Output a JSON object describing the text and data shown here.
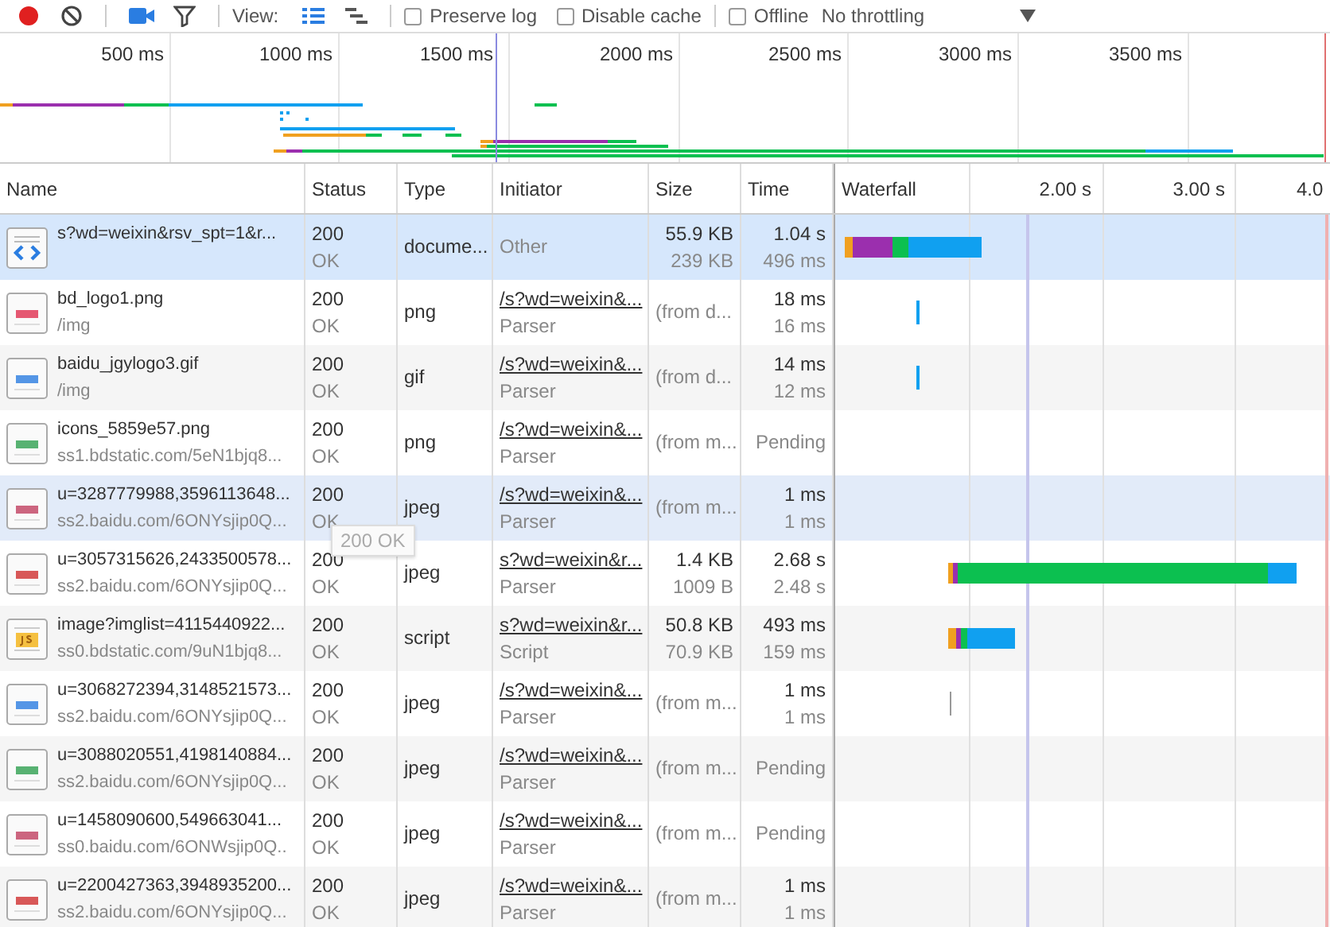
{
  "toolbar": {
    "recording": true,
    "view_label": "View:",
    "view_modes": [
      {
        "kind": "list",
        "selected": true
      },
      {
        "kind": "waterfall",
        "selected": false
      }
    ],
    "options": [
      {
        "label": "Preserve log",
        "checked": false
      },
      {
        "label": "Disable cache",
        "checked": false
      }
    ],
    "offline": {
      "label": "Offline",
      "checked": false
    },
    "throttling": "No throttling"
  },
  "overview": {
    "ticks": [
      "500 ms",
      "1000 ms",
      "1500 ms",
      "2000 ms",
      "2500 ms",
      "3000 ms",
      "3500 ms"
    ]
  },
  "table": {
    "columns": [
      "Name",
      "Status",
      "Type",
      "Initiator",
      "Size",
      "Time",
      "Waterfall"
    ],
    "waterfall_ticks": [
      "2.00 s",
      "3.00 s",
      "4.0"
    ],
    "rows": [
      {
        "kind": "document",
        "name": "s?wd=weixin&rsv_spt=1&r...",
        "status": "200",
        "status_text": "OK",
        "type": "docume...",
        "initiator_cause": "Other",
        "size": "55.9 KB",
        "resource_size": "239 KB",
        "time": "1.04 s",
        "latency": "496 ms",
        "selected": true,
        "hovered": false
      },
      {
        "kind": "image",
        "name": "bd_logo1.png",
        "path": "/img",
        "status": "200",
        "status_text": "OK",
        "type": "png",
        "initiator_link": "/s?wd=weixin&...",
        "initiator_cause": "Parser",
        "size": "(from d...",
        "time": "18 ms",
        "latency": "16 ms",
        "selected": false,
        "hovered": false
      },
      {
        "kind": "image",
        "name": "baidu_jgylogo3.gif",
        "path": "/img",
        "status": "200",
        "status_text": "OK",
        "type": "gif",
        "initiator_link": "/s?wd=weixin&...",
        "initiator_cause": "Parser",
        "size": "(from d...",
        "time": "14 ms",
        "latency": "12 ms",
        "selected": false,
        "hovered": false
      },
      {
        "kind": "image",
        "name": "icons_5859e57.png",
        "path": "ss1.bdstatic.com/5eN1bjq8...",
        "status": "200",
        "status_text": "OK",
        "type": "png",
        "initiator_link": "/s?wd=weixin&...",
        "initiator_cause": "Parser",
        "size": "(from m...",
        "time": "Pending",
        "selected": false,
        "hovered": false
      },
      {
        "kind": "image",
        "name": "u=3287779988,3596113648...",
        "path": "ss2.baidu.com/6ONYsjip0Q...",
        "status": "200",
        "status_text": "OK",
        "type": "jpeg",
        "initiator_link": "/s?wd=weixin&...",
        "initiator_cause": "Parser",
        "size": "(from m...",
        "time": "1 ms",
        "latency": "1 ms",
        "selected": false,
        "hovered": true
      },
      {
        "kind": "image",
        "name": "u=3057315626,2433500578...",
        "path": "ss2.baidu.com/6ONYsjip0Q...",
        "status": "200",
        "status_text": "OK",
        "type": "jpeg",
        "initiator_link": "s?wd=weixin&r...",
        "initiator_cause": "Parser",
        "size": "1.4 KB",
        "resource_size": "1009 B",
        "time": "2.68 s",
        "latency": "2.48 s",
        "selected": false,
        "hovered": false
      },
      {
        "kind": "script",
        "name": "image?imglist=4115440922...",
        "path": "ss0.bdstatic.com/9uN1bjq8...",
        "status": "200",
        "status_text": "OK",
        "type": "script",
        "initiator_link": "s?wd=weixin&r...",
        "initiator_cause": "Script",
        "size": "50.8 KB",
        "resource_size": "70.9 KB",
        "time": "493 ms",
        "latency": "159 ms",
        "selected": false,
        "hovered": false
      },
      {
        "kind": "image",
        "name": "u=3068272394,3148521573...",
        "path": "ss2.baidu.com/6ONYsjip0Q...",
        "status": "200",
        "status_text": "OK",
        "type": "jpeg",
        "initiator_link": "/s?wd=weixin&...",
        "initiator_cause": "Parser",
        "size": "(from m...",
        "time": "1 ms",
        "latency": "1 ms",
        "selected": false,
        "hovered": false
      },
      {
        "kind": "image",
        "name": "u=3088020551,4198140884...",
        "path": "ss2.baidu.com/6ONYsjip0Q...",
        "status": "200",
        "status_text": "OK",
        "type": "jpeg",
        "initiator_link": "/s?wd=weixin&...",
        "initiator_cause": "Parser",
        "size": "(from m...",
        "time": "Pending",
        "selected": false,
        "hovered": false
      },
      {
        "kind": "image",
        "name": "u=1458090600,549663041...",
        "path": "ss0.baidu.com/6ONWsjip0Q..",
        "status": "200",
        "status_text": "OK",
        "type": "jpeg",
        "initiator_link": "/s?wd=weixin&...",
        "initiator_cause": "Parser",
        "size": "(from m...",
        "time": "Pending",
        "selected": false,
        "hovered": false
      },
      {
        "kind": "image",
        "name": "u=2200427363,3948935200...",
        "path": "ss2.baidu.com/6ONYsjip0Q...",
        "status": "200",
        "status_text": "OK",
        "type": "jpeg",
        "initiator_link": "/s?wd=weixin&...",
        "initiator_cause": "Parser",
        "size": "(from m...",
        "time": "1 ms",
        "latency": "1 ms",
        "selected": false,
        "hovered": false
      }
    ]
  },
  "tooltip": "200 OK"
}
